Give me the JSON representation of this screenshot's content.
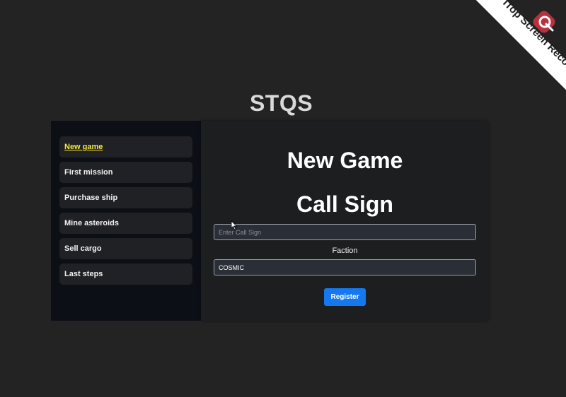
{
  "app": {
    "title": "STQS"
  },
  "sidebar": {
    "items": [
      {
        "label": "New game",
        "active": true
      },
      {
        "label": "First mission",
        "active": false
      },
      {
        "label": "Purchase ship",
        "active": false
      },
      {
        "label": "Mine asteroids",
        "active": false
      },
      {
        "label": "Sell cargo",
        "active": false
      },
      {
        "label": "Last steps",
        "active": false
      }
    ]
  },
  "main": {
    "heading": "New Game",
    "callsign_heading": "Call Sign",
    "callsign_input": {
      "value": "",
      "placeholder": "Enter Call Sign"
    },
    "faction_label": "Faction",
    "faction_input": {
      "value": "COSMIC"
    },
    "register_label": "Register"
  },
  "watermark": {
    "text": "iTop Screen Recorder",
    "logo_icon": "itop-recorder-logo-icon"
  },
  "colors": {
    "background": "#232323",
    "sidebar": "#0c0f16",
    "panel": "#1d1e20",
    "active_link": "#f7e93a",
    "button": "#1479ef"
  }
}
